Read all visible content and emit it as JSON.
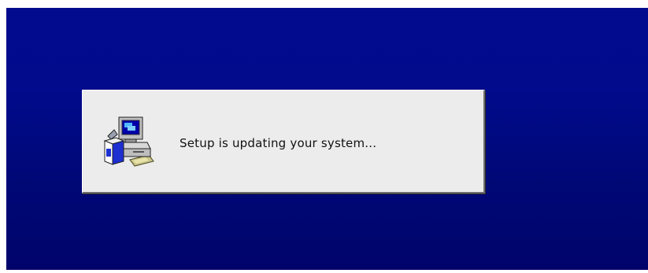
{
  "dialog": {
    "icon": "setup-computer-icon",
    "message": "Setup is updating your system..."
  },
  "colors": {
    "background": "#010b8c",
    "dialog": "#ececec",
    "text": "#111111"
  }
}
